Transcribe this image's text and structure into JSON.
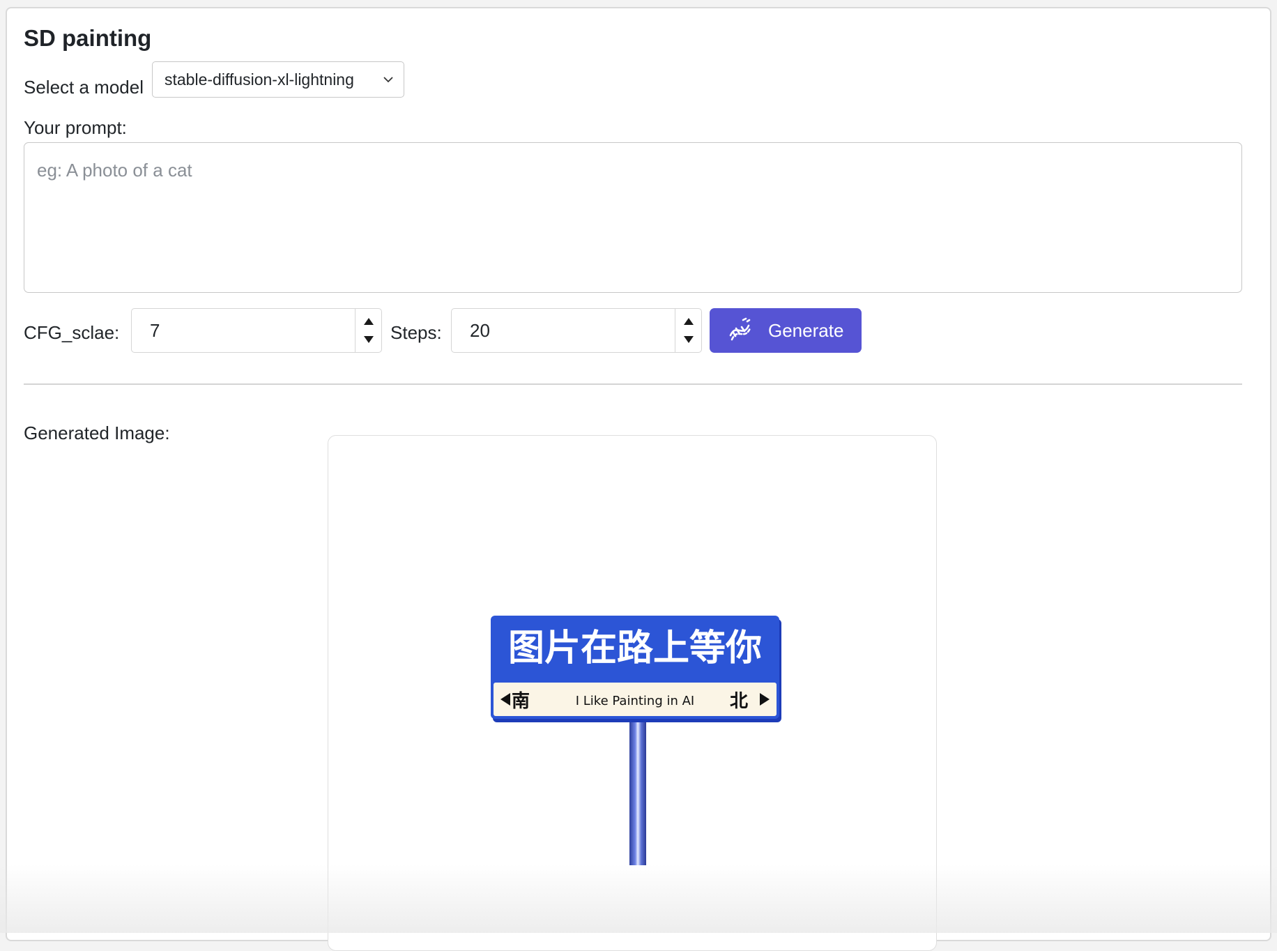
{
  "app": {
    "title": "SD painting"
  },
  "model": {
    "label": "Select a model",
    "selected": "stable-diffusion-xl-lightning"
  },
  "prompt": {
    "label": "Your prompt:",
    "placeholder": "eg: A photo of a cat",
    "value": ""
  },
  "params": {
    "cfg_label": "CFG_sclae:",
    "cfg_value": "7",
    "steps_label": "Steps:",
    "steps_value": "20"
  },
  "generate": {
    "label": "Generate",
    "icon": "dna-icon"
  },
  "output": {
    "label": "Generated Image:",
    "placeholder_sign": {
      "main_text": "图片在路上等你",
      "left_dir": "南",
      "sub_text": "I Like Painting in AI",
      "right_dir": "北",
      "panel_color": "#2c55d6",
      "strip_color": "#fbf5e6"
    }
  },
  "colors": {
    "accent": "#5654d4",
    "page_bg": "#f3f3f3"
  }
}
